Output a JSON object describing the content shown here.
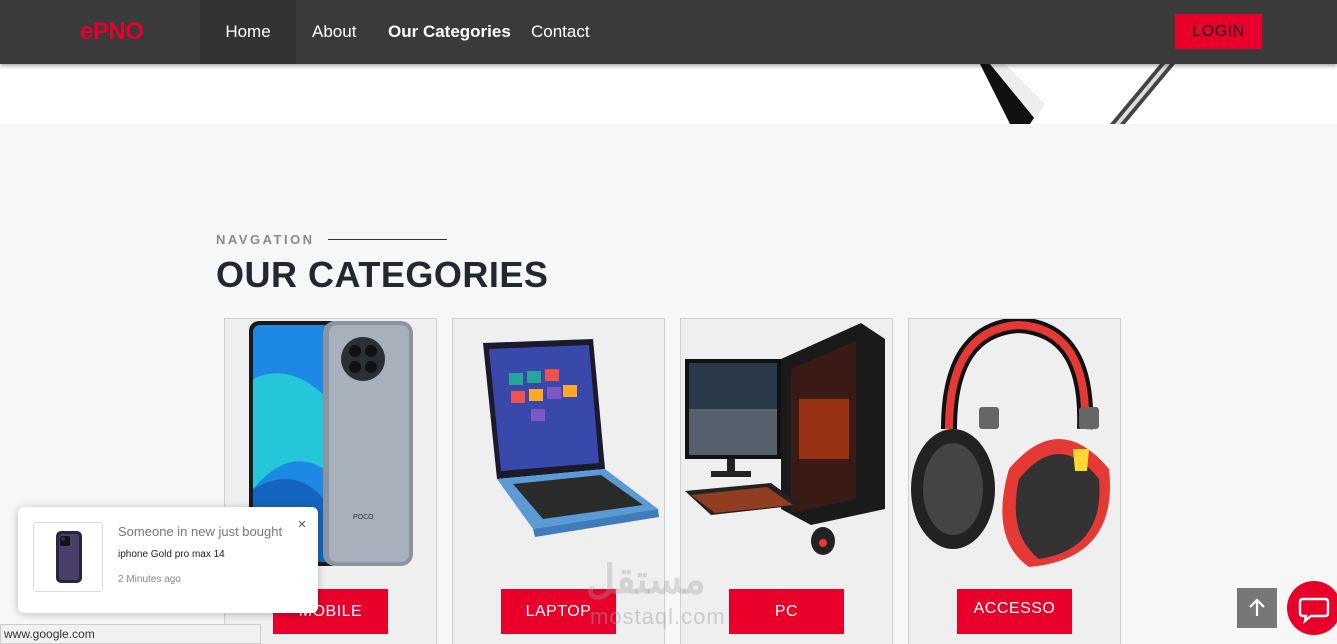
{
  "brand": "ePNO",
  "nav": {
    "home": "Home",
    "about": "About",
    "categories": "Our Categories",
    "contact": "Contact",
    "login": "LOGIN"
  },
  "section": {
    "eyebrow": "NAVGATION",
    "heading": "OUR CATEGORIES"
  },
  "categories": [
    {
      "label": "MOBILE",
      "image": "smartphone-image"
    },
    {
      "label": "LAPTOP",
      "image": "laptop-image"
    },
    {
      "label": "PC",
      "image": "desktop-pc-image"
    },
    {
      "label": "ACCESSO",
      "image": "headphones-image"
    }
  ],
  "popup": {
    "title": "Someone in new just bought",
    "product": "iphone Gold pro max 14",
    "time": "2 Minutes ago",
    "close": "×"
  },
  "status_url": "www.google.com",
  "watermark": {
    "arabic": "مستقل",
    "latin": "mostaql.com"
  },
  "colors": {
    "accent": "#e8002b",
    "navbar": "#3a3a3a",
    "section_bg": "#f6f7f7"
  }
}
